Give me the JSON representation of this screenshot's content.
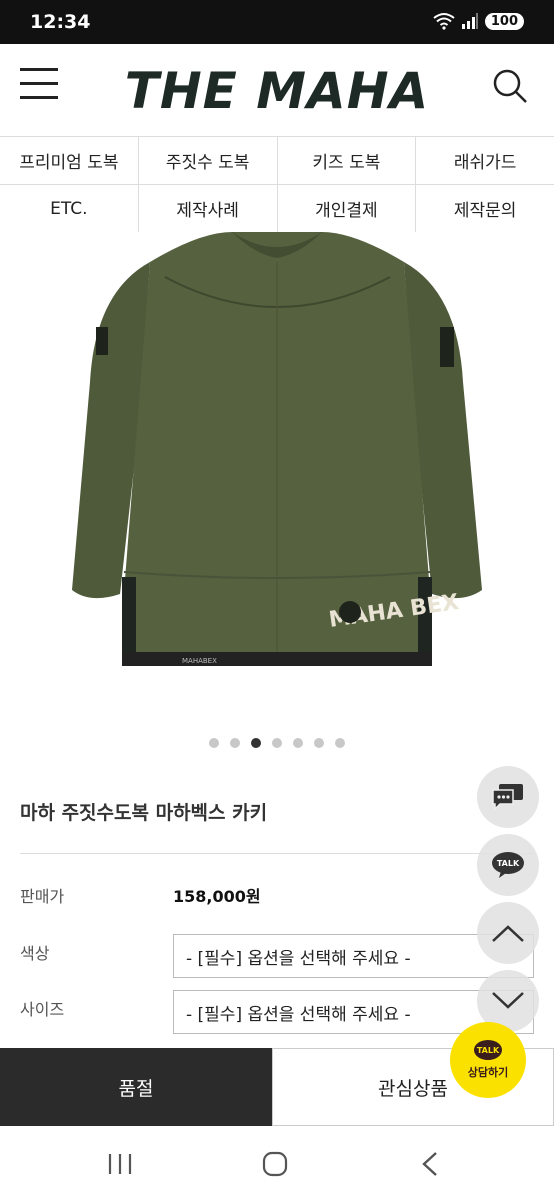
{
  "status_bar": {
    "time": "12:34",
    "battery": "100"
  },
  "header": {
    "logo": "THE MAHA"
  },
  "menu": {
    "row1": [
      "프리미엄 도복",
      "주짓수 도복",
      "키즈 도복",
      "래쉬가드"
    ],
    "row2": [
      "ETC.",
      "제작사례",
      "개인결제",
      "제작문의"
    ]
  },
  "carousel": {
    "total": 7,
    "active_index": 2
  },
  "product": {
    "title": "마하 주짓수도복 마하벡스 카키",
    "price_label": "판매가",
    "price": "158,000원",
    "color_label": "색상",
    "color_placeholder": "- [필수] 옵션을 선택해 주세요 -",
    "size_label": "사이즈",
    "size_placeholder": "- [필수] 옵션을 선택해 주세요 -",
    "image_print": "MAHA BEX",
    "image_hem_text": "MAHABEX"
  },
  "floating": {
    "talk": "TALK",
    "kakao_bubble": "TALK",
    "kakao_label": "상담하기"
  },
  "bottom_bar": {
    "sold_out": "품절",
    "wishlist": "관심상품"
  },
  "colors": {
    "khaki": "#4f5a3a",
    "dark": "#2b2b2b",
    "kakao": "#fae100"
  }
}
